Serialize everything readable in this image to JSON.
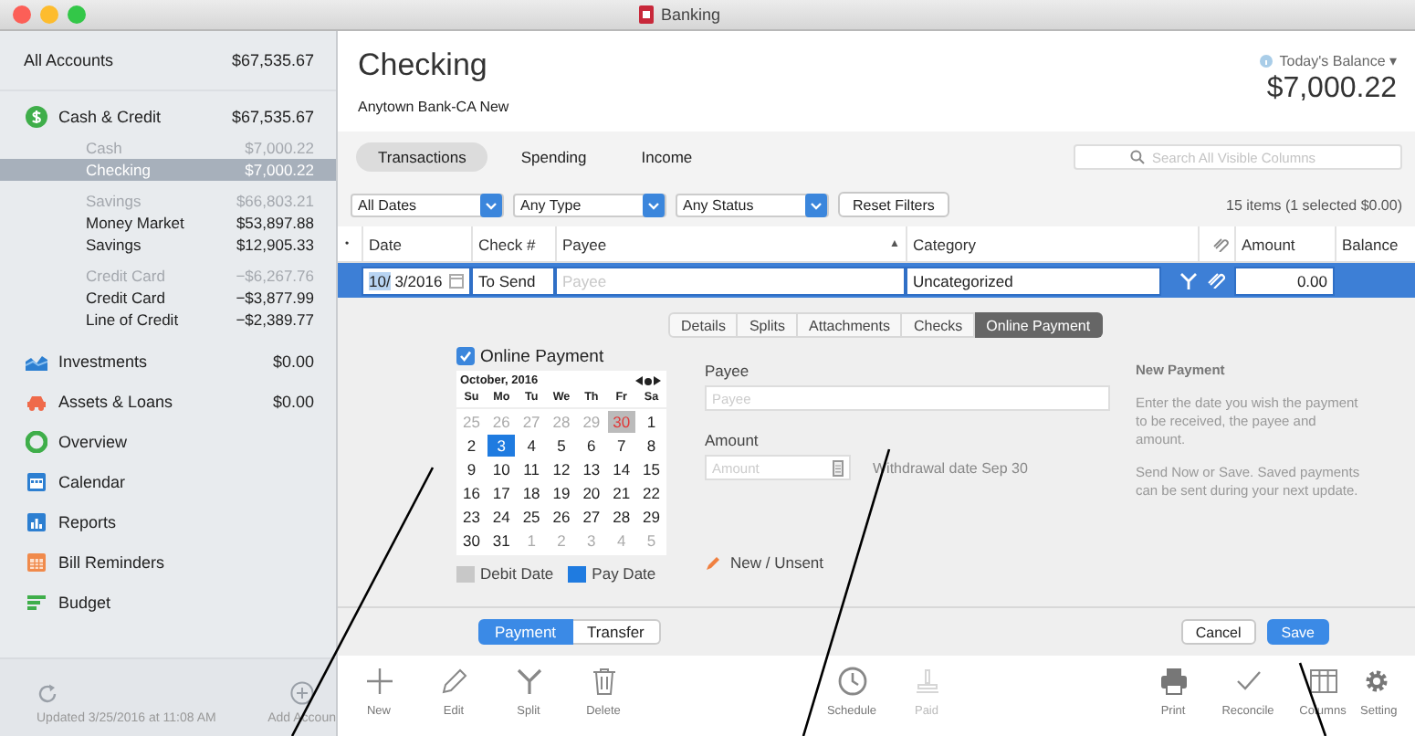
{
  "window": {
    "title": "Banking"
  },
  "sidebar": {
    "all_accounts": {
      "label": "All Accounts",
      "amount": "$67,535.67"
    },
    "sections": [
      {
        "label": "Cash & Credit",
        "amount": "$67,535.67",
        "children": [
          {
            "kind": "heading",
            "label": "Cash",
            "amount": "$7,000.22",
            "selected": false
          },
          {
            "kind": "account",
            "label": "Checking",
            "amount": "$7,000.22",
            "selected": true
          },
          {
            "kind": "heading",
            "label": "Savings",
            "amount": "$66,803.21",
            "selected": false
          },
          {
            "kind": "account",
            "label": "Money Market",
            "amount": "$53,897.88",
            "selected": false
          },
          {
            "kind": "account",
            "label": "Savings",
            "amount": "$12,905.33",
            "selected": false
          },
          {
            "kind": "heading",
            "label": "Credit Card",
            "amount": "−$6,267.76",
            "selected": false
          },
          {
            "kind": "account",
            "label": "Credit Card",
            "amount": "−$3,877.99",
            "selected": false
          },
          {
            "kind": "account",
            "label": "Line of Credit",
            "amount": "−$2,389.77",
            "selected": false
          }
        ]
      },
      {
        "label": "Investments",
        "amount": "$0.00"
      },
      {
        "label": "Assets & Loans",
        "amount": "$0.00"
      },
      {
        "label": "Overview"
      },
      {
        "label": "Calendar"
      },
      {
        "label": "Reports"
      },
      {
        "label": "Bill Reminders"
      },
      {
        "label": "Budget"
      }
    ],
    "footer": {
      "updated": "Updated 3/25/2016 at 11:08 AM",
      "add": "Add Accoun"
    }
  },
  "header": {
    "title": "Checking",
    "subtitle": "Anytown Bank-CA New",
    "balance_label": "Today's Balance ▾",
    "balance": "$7,000.22"
  },
  "view_tabs": [
    {
      "label": "Transactions",
      "selected": true
    },
    {
      "label": "Spending",
      "selected": false
    },
    {
      "label": "Income",
      "selected": false
    }
  ],
  "search": {
    "placeholder": "Search All Visible Columns"
  },
  "filters": {
    "selects": [
      "All Dates",
      "Any Type",
      "Any Status"
    ],
    "reset": "Reset Filters",
    "summary": "15 items (1 selected $0.00)"
  },
  "table": {
    "columns": [
      "•",
      "Date",
      "Check #",
      "Payee",
      "Category",
      "Amount",
      "Balance"
    ],
    "sort_mark": "▲",
    "row": {
      "date_month": "10/",
      "date_rest": " 3/2016",
      "check": "To Send",
      "payee_placeholder": "Payee",
      "category": "Uncategorized",
      "amount": "0.00",
      "selected": true
    }
  },
  "detail_tabs": [
    {
      "label": "Details",
      "selected": false
    },
    {
      "label": "Splits",
      "selected": false
    },
    {
      "label": "Attachments",
      "selected": false
    },
    {
      "label": "Checks",
      "selected": false
    },
    {
      "label": "Online Payment",
      "selected": true
    }
  ],
  "online_payment": {
    "label": "Online Payment",
    "checked": true
  },
  "calendar": {
    "month": "October, 2016",
    "weekdays": [
      "Su",
      "Mo",
      "Tu",
      "We",
      "Th",
      "Fr",
      "Sa"
    ],
    "weeks": [
      [
        {
          "day": "25",
          "kind": "outside"
        },
        {
          "day": "26",
          "kind": "outside"
        },
        {
          "day": "27",
          "kind": "outside"
        },
        {
          "day": "28",
          "kind": "outside"
        },
        {
          "day": "29",
          "kind": "outside"
        },
        {
          "day": "30",
          "kind": "debit"
        },
        {
          "day": "1",
          "kind": "normal"
        }
      ],
      [
        {
          "day": "2",
          "kind": "normal"
        },
        {
          "day": "3",
          "kind": "pay"
        },
        {
          "day": "4",
          "kind": "normal"
        },
        {
          "day": "5",
          "kind": "normal"
        },
        {
          "day": "6",
          "kind": "normal"
        },
        {
          "day": "7",
          "kind": "normal"
        },
        {
          "day": "8",
          "kind": "normal"
        }
      ],
      [
        {
          "day": "9",
          "kind": "normal"
        },
        {
          "day": "10",
          "kind": "normal"
        },
        {
          "day": "11",
          "kind": "normal"
        },
        {
          "day": "12",
          "kind": "normal"
        },
        {
          "day": "13",
          "kind": "normal"
        },
        {
          "day": "14",
          "kind": "normal"
        },
        {
          "day": "15",
          "kind": "normal"
        }
      ],
      [
        {
          "day": "16",
          "kind": "normal"
        },
        {
          "day": "17",
          "kind": "normal"
        },
        {
          "day": "18",
          "kind": "normal"
        },
        {
          "day": "19",
          "kind": "normal"
        },
        {
          "day": "20",
          "kind": "normal"
        },
        {
          "day": "21",
          "kind": "normal"
        },
        {
          "day": "22",
          "kind": "normal"
        }
      ],
      [
        {
          "day": "23",
          "kind": "normal"
        },
        {
          "day": "24",
          "kind": "normal"
        },
        {
          "day": "25",
          "kind": "normal"
        },
        {
          "day": "26",
          "kind": "normal"
        },
        {
          "day": "27",
          "kind": "normal"
        },
        {
          "day": "28",
          "kind": "normal"
        },
        {
          "day": "29",
          "kind": "normal"
        }
      ],
      [
        {
          "day": "30",
          "kind": "normal"
        },
        {
          "day": "31",
          "kind": "normal"
        },
        {
          "day": "1",
          "kind": "outside"
        },
        {
          "day": "2",
          "kind": "outside"
        },
        {
          "day": "3",
          "kind": "outside"
        },
        {
          "day": "4",
          "kind": "outside"
        },
        {
          "day": "5",
          "kind": "outside"
        }
      ]
    ],
    "legend": [
      "Debit Date",
      "Pay Date"
    ]
  },
  "payment_form": {
    "payee_label": "Payee",
    "payee_placeholder": "Payee",
    "amount_label": "Amount",
    "amount_placeholder": "Amount",
    "withdrawal": "Withdrawal date Sep 30",
    "status": "New / Unsent"
  },
  "help": {
    "title": "New Payment",
    "paragraphs": [
      "Enter the date you wish the payment to be received, the payee and amount.",
      "Send Now or Save. Saved payments can be sent during your next update."
    ]
  },
  "mode_tabs": [
    {
      "label": "Payment",
      "selected": true
    },
    {
      "label": "Transfer",
      "selected": false
    }
  ],
  "actions": [
    {
      "label": "Cancel",
      "kind": "plain"
    },
    {
      "label": "Save",
      "kind": "primary"
    }
  ],
  "toolbar": [
    [
      {
        "label": "New",
        "disabled": false
      },
      {
        "label": "Edit",
        "disabled": false
      },
      {
        "label": "Split",
        "disabled": false
      },
      {
        "label": "Delete",
        "disabled": false
      }
    ],
    [
      {
        "label": "Schedule",
        "disabled": false
      },
      {
        "label": "Paid",
        "disabled": true
      }
    ],
    [
      {
        "label": "Print",
        "disabled": false
      },
      {
        "label": "Reconcile",
        "disabled": false
      },
      {
        "label": "Columns",
        "disabled": false
      },
      {
        "label": "Setting",
        "disabled": false
      }
    ]
  ]
}
